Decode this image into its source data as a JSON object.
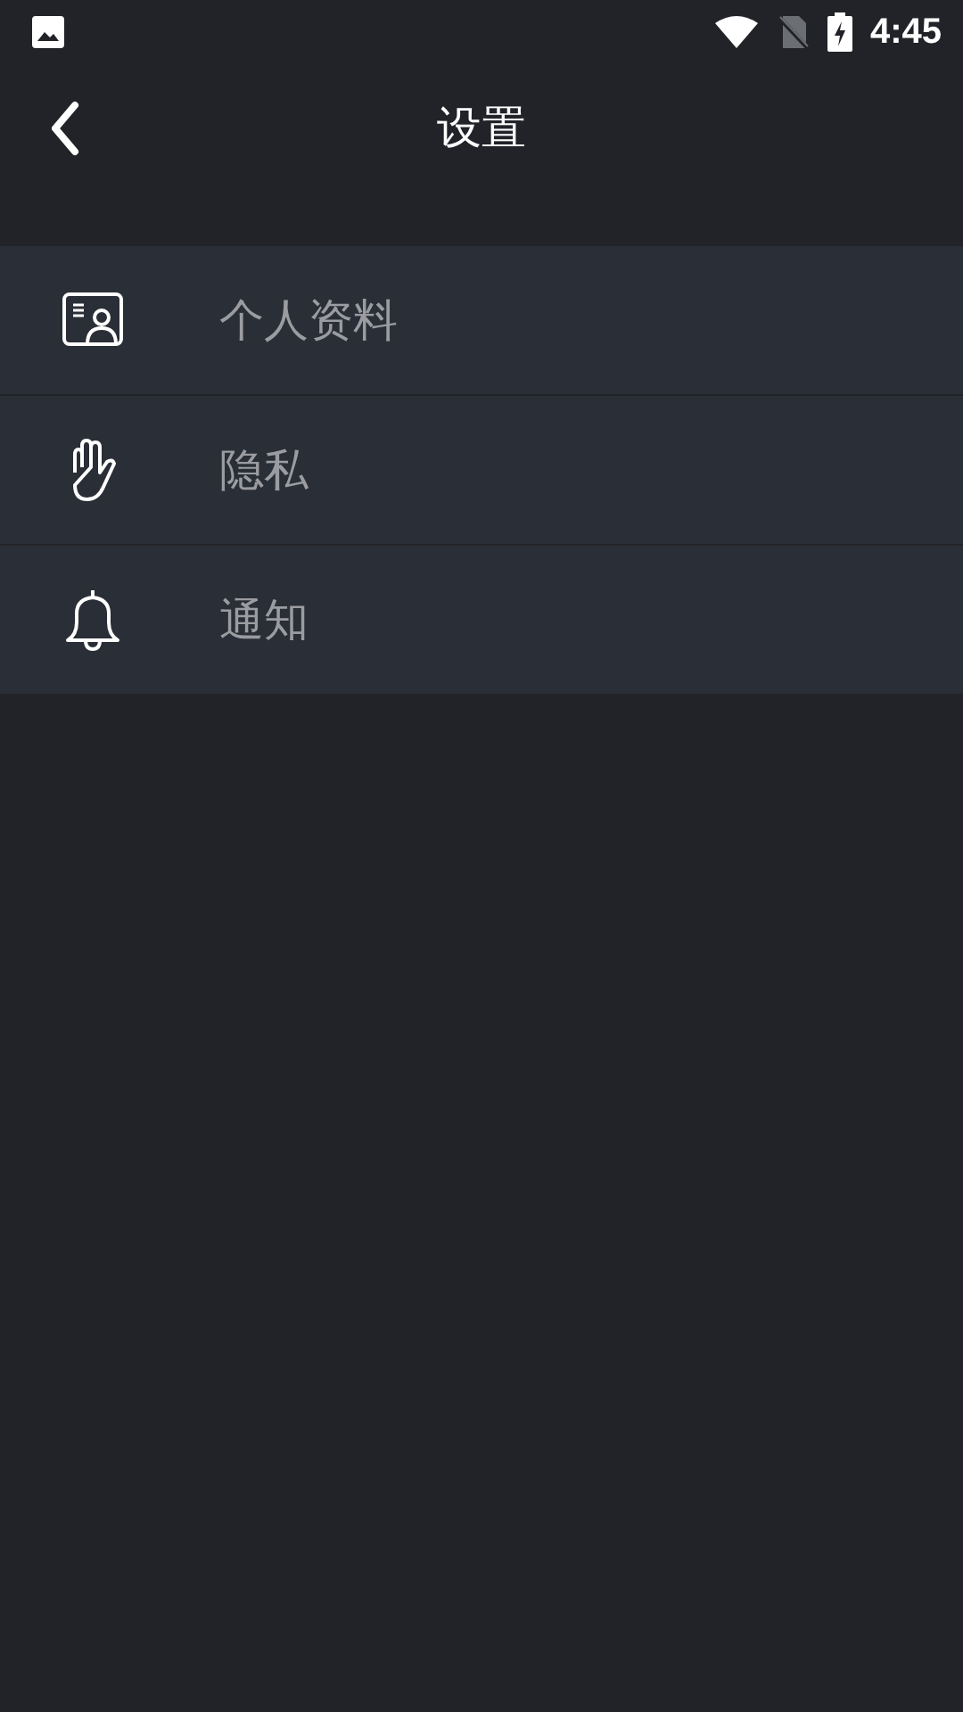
{
  "status_bar": {
    "time": "4:45"
  },
  "header": {
    "title": "设置"
  },
  "menu": [
    {
      "kind": "profile",
      "label": "个人资料"
    },
    {
      "kind": "privacy",
      "label": "隐私"
    },
    {
      "kind": "notification",
      "label": "通知"
    }
  ]
}
